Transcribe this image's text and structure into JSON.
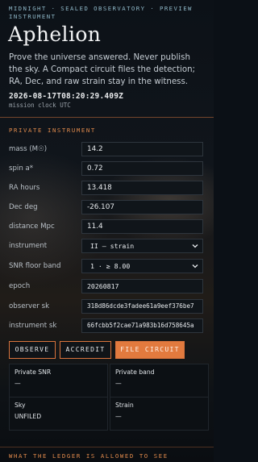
{
  "header": {
    "kicker": "MIDNIGHT · SEALED OBSERVATORY · PREVIEW INSTRUMENT",
    "title": "Aphelion",
    "lede": "Prove the universe answered. Never publish the sky. A Compact circuit files the detection; RA, Dec, and raw strain stay in the witness.",
    "clock_value": "2026-08-17T08:20:29.409Z",
    "clock_label": "mission clock UTC"
  },
  "private_instrument": {
    "section_title": "PRIVATE INSTRUMENT",
    "fields": [
      {
        "label": "mass (M☉)",
        "value": "14.2"
      },
      {
        "label": "spin a*",
        "value": "0.72"
      },
      {
        "label": "RA hours",
        "value": "13.418"
      },
      {
        "label": "Dec deg",
        "value": "-26.107"
      },
      {
        "label": "distance Mpc",
        "value": "11.4"
      }
    ],
    "instrument": {
      "label": "instrument",
      "selected": "II — strain"
    },
    "snr_floor": {
      "label": "SNR floor band",
      "selected": "1 · ≥ 8.00"
    },
    "epoch": {
      "label": "epoch",
      "value": "20260817"
    },
    "observer_sk": {
      "label": "observer sk",
      "value": "318d86dcde3fadee61a9eef376be7"
    },
    "instrument_sk": {
      "label": "instrument sk",
      "value": "66fcbb5f2cae71a983b16d758645a"
    }
  },
  "actions": {
    "observe": "OBSERVE",
    "accredit": "ACCREDIT",
    "file_circuit": "FILE CIRCUIT"
  },
  "results": {
    "private_snr": {
      "label": "Private SNR",
      "value": "—"
    },
    "private_band": {
      "label": "Private band",
      "value": "—"
    },
    "sky": {
      "label": "Sky",
      "value": "UNFILED"
    },
    "strain": {
      "label": "Strain",
      "value": "—"
    }
  },
  "ledger": {
    "section_title": "WHAT THE LEDGER IS ALLOWED TO SEE"
  },
  "colors": {
    "accent": "#e27a3e",
    "kicker": "#8fb8c8",
    "background": "#0b1016"
  }
}
